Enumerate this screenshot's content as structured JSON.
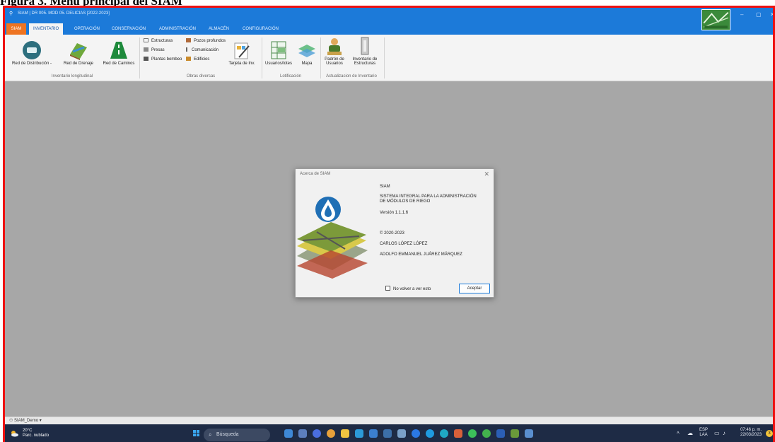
{
  "caption": "Figura 3. Menú principal del SIAM",
  "window": {
    "title": "SIAM | DR 005. MOD 05. DELICIAS [2022-2023]",
    "minimize": "–",
    "maximize": "▢",
    "close": "✕"
  },
  "menu": {
    "tabs": [
      "SIAM",
      "INVENTARIO",
      "OPERACIÓN",
      "CONSERVACIÓN",
      "ADMINISTRACIÓN",
      "ALMACÉN",
      "CONFIGURACIÓN"
    ],
    "active": "INVENTARIO"
  },
  "ribbon": {
    "red_distribucion": "Red de Distribución",
    "red_drenaje": "Red de Drenaje",
    "red_caminos": "Red de Caminos",
    "group_longitudinal": "Inventario longitudinal",
    "estructuras": "Estructuras",
    "presas": "Presas",
    "plantas_bombeo": "Plantas bombeo",
    "pozos_profundos": "Pozos profundos",
    "comunicacion": "Comunicación",
    "edificios": "Edificios",
    "tarjeta_inv": "Tarjeta de Inv.",
    "group_obras": "Obras diversas",
    "usuarios_lotes": "Usuarios/lotes",
    "mapa": "Mapa",
    "group_lotificacion": "Lotificación",
    "padron_usuarios_1": "Padrón de",
    "padron_usuarios_2": "Usuarios",
    "inventario_estructuras_1": "Inventario de",
    "inventario_estructuras_2": "Estructuras",
    "group_actualizacion": "Actualizacion de Inventario"
  },
  "dialog": {
    "title": "Acerca de SIAM",
    "close": "✕",
    "app_name": "SIAM",
    "description_1": "SISTEMA INTEGRAL PARA LA ADMINISTRACIÓN",
    "description_2": "DE MÓDULOS DE RIEGO",
    "version": "Versión 1.1.1.6",
    "copyright": "© 2020-2023",
    "author_1": "CARLOS LÓPEZ LÓPEZ",
    "author_2": "ADOLFO EMMANUEL JUÁREZ MÁRQUEZ",
    "checkbox_label": "No volver a ver esto",
    "accept_button": "Aceptar"
  },
  "statusbar": {
    "user": "SIAM_Demo"
  },
  "taskbar": {
    "temperature": "20°C",
    "weather": "Parc. nublado",
    "search_placeholder": "Búsqueda",
    "lang_1": "ESP",
    "lang_2": "LAA",
    "time": "07:46 p. m.",
    "date": "22/03/2023",
    "notifications": "3"
  },
  "colors": {
    "accent": "#1c7ad9",
    "siam_tab": "#ee7422",
    "frame_border": "#ee1111",
    "taskbar": "#1e2b45"
  }
}
